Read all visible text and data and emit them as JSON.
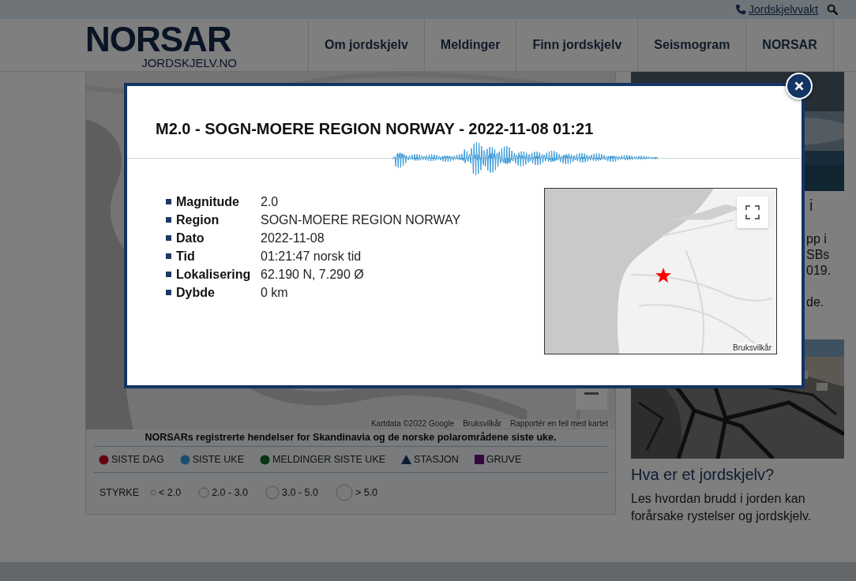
{
  "top_bar": {
    "link": "Jordskjelvvakt"
  },
  "header": {
    "logo": {
      "name": "NORSAR",
      "subtitle": "JORDSKJELV.NO"
    },
    "nav": [
      {
        "label": "Om jordskjelv"
      },
      {
        "label": "Meldinger"
      },
      {
        "label": "Finn jordskjelv"
      },
      {
        "label": "Seismogram"
      },
      {
        "label": "NORSAR"
      }
    ]
  },
  "map": {
    "attribution": [
      "Kartdata ©2022 Google",
      "Bruksvilkår",
      "Rapportér en feil med kartet"
    ]
  },
  "legend": {
    "title": "NORSARs registrerte hendelser for Skandinavia og de norske polarområdene siste uke.",
    "types": [
      {
        "label": "SISTE DAG",
        "kind": "dot",
        "color": "#68010e"
      },
      {
        "label": "SISTE UKE",
        "kind": "dot",
        "color": "#1d4d6c"
      },
      {
        "label": "MELDINGER SISTE UKE",
        "kind": "dot",
        "color": "#07350f"
      },
      {
        "label": "STASJON",
        "kind": "triangle",
        "color": "#0e1d33"
      },
      {
        "label": "GRUVE",
        "kind": "square",
        "color": "#350840"
      }
    ],
    "strength_label": "STYRKE",
    "sizes": [
      {
        "label": "< 2.0"
      },
      {
        "label": "2.0 - 3.0"
      },
      {
        "label": "3.0 - 5.0"
      },
      {
        "label": "> 5.0"
      }
    ]
  },
  "sidebar": {
    "articles": [
      {
        "kind": "cut",
        "title": "i",
        "lines": [
          "pp i",
          "SBs",
          "019.",
          "de."
        ]
      },
      {
        "kind": "full",
        "title": "Hva er et jordskjelv?",
        "lines": [
          "Les hvordan brudd i jorden kan",
          "forårsake rystelser og jordskjelv."
        ]
      }
    ]
  },
  "modal": {
    "title": "M2.0 - SOGN-MOERE REGION NORWAY - 2022-11-08 01:21",
    "fields": [
      {
        "label": "Magnitude",
        "value": "2.0"
      },
      {
        "label": "Region",
        "value": "SOGN-MOERE REGION NORWAY"
      },
      {
        "label": "Dato",
        "value": "2022-11-08"
      },
      {
        "label": "Tid",
        "value": "01:21:47 norsk tid"
      },
      {
        "label": "Lokalisering",
        "value": "62.190 N, 7.290 Ø"
      },
      {
        "label": "Dybde",
        "value": "0 km"
      }
    ],
    "map": {
      "attribution": "Bruksvilkår"
    }
  }
}
